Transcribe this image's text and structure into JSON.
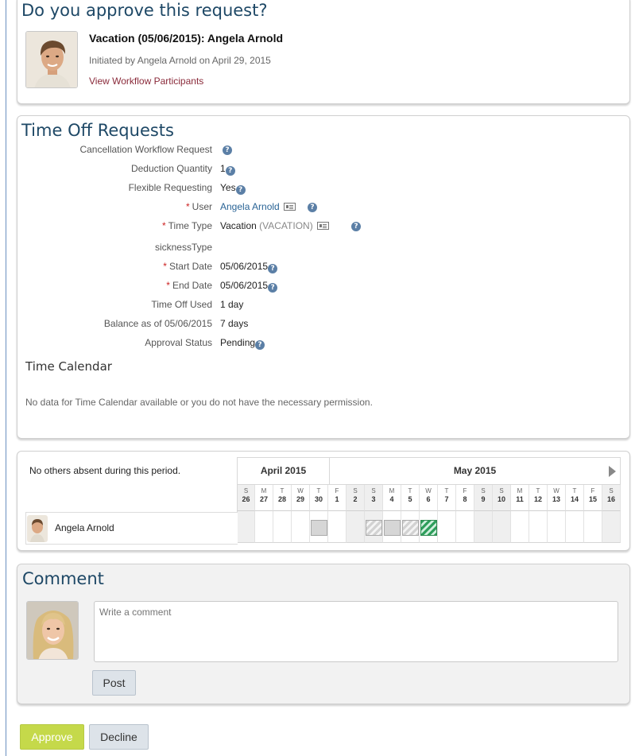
{
  "approval": {
    "heading": "Do you approve this request?",
    "request_title": "Vacation (05/06/2015): Angela Arnold",
    "initiated_by": "Initiated by Angela Arnold on April 29, 2015",
    "participants_link": "View Workflow Participants"
  },
  "time_off": {
    "heading": "Time Off Requests",
    "fields": [
      {
        "label": "Cancellation Workflow Request",
        "value": "",
        "required": false
      },
      {
        "label": "Deduction Quantity",
        "value": "1",
        "required": false
      },
      {
        "label": "Flexible Requesting",
        "value": "Yes",
        "required": false
      },
      {
        "label": "User",
        "value": "Angela Arnold",
        "required": true
      },
      {
        "label": "Time Type",
        "value": "Vacation",
        "value_extra": "(VACATION)",
        "required": true
      },
      {
        "label": "sicknessType",
        "value": "",
        "required": false
      },
      {
        "label": "Start Date",
        "value": "05/06/2015",
        "required": true
      },
      {
        "label": "End Date",
        "value": "05/06/2015",
        "required": true
      },
      {
        "label": "Time Off Used",
        "value": "1 day",
        "required": false
      },
      {
        "label": "Balance as of 05/06/2015",
        "value": "7 days",
        "required": false
      },
      {
        "label": "Approval Status",
        "value": "Pending",
        "required": false
      }
    ],
    "required_marker": "*",
    "help_glyph": "?",
    "calendar_heading": "Time Calendar",
    "calendar_empty": "No data for Time Calendar available or you do not have the necessary permission."
  },
  "absence": {
    "no_others": "No others absent during this period.",
    "months": [
      "April 2015",
      "May 2015"
    ],
    "days": [
      {
        "l": "S",
        "n": "26"
      },
      {
        "l": "M",
        "n": "27"
      },
      {
        "l": "T",
        "n": "28"
      },
      {
        "l": "W",
        "n": "29"
      },
      {
        "l": "T",
        "n": "30"
      },
      {
        "l": "F",
        "n": "1"
      },
      {
        "l": "S",
        "n": "2"
      },
      {
        "l": "S",
        "n": "3"
      },
      {
        "l": "M",
        "n": "4"
      },
      {
        "l": "T",
        "n": "5"
      },
      {
        "l": "W",
        "n": "6"
      },
      {
        "l": "T",
        "n": "7"
      },
      {
        "l": "F",
        "n": "8"
      },
      {
        "l": "S",
        "n": "9"
      },
      {
        "l": "S",
        "n": "10"
      },
      {
        "l": "M",
        "n": "11"
      },
      {
        "l": "T",
        "n": "12"
      },
      {
        "l": "W",
        "n": "13"
      },
      {
        "l": "T",
        "n": "14"
      },
      {
        "l": "F",
        "n": "15"
      },
      {
        "l": "S",
        "n": "16"
      }
    ],
    "employee": "Angela Arnold",
    "next_icon": "triangle-right-icon"
  },
  "comment": {
    "heading": "Comment",
    "placeholder": "Write a comment",
    "post_label": "Post"
  },
  "actions": {
    "approve_label": "Approve",
    "decline_label": "Decline"
  },
  "colors": {
    "heading": "#1e4866",
    "link": "#2a6496",
    "approve": "#c5d94a",
    "decline": "#dde3e9"
  }
}
